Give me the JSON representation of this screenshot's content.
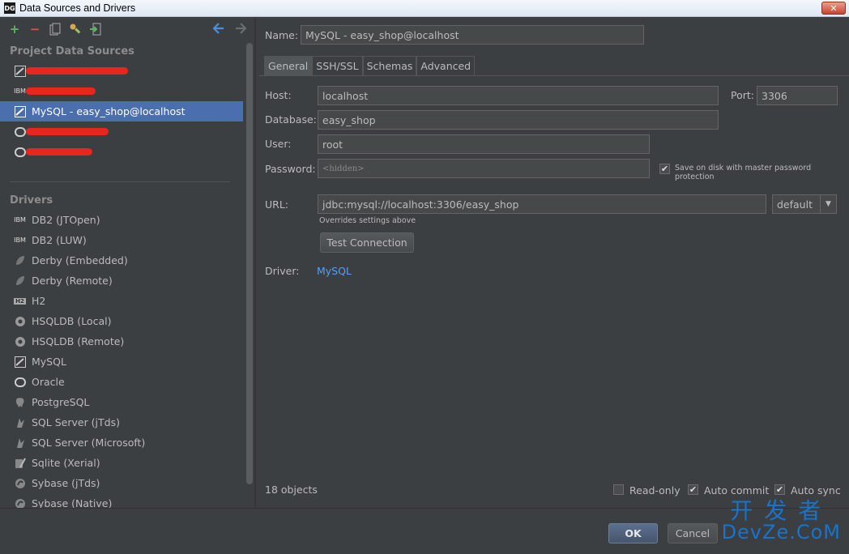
{
  "window": {
    "title": "Data Sources and Drivers",
    "app_icon": "DG",
    "close_label": "✕"
  },
  "left": {
    "toolbar": {
      "add": "+",
      "remove": "−"
    },
    "project_header": "Project Data Sources",
    "sources": [
      {
        "label": "",
        "icon": "mysql-icon"
      },
      {
        "label": "",
        "icon": "ibm-icon"
      },
      {
        "label": "MySQL - easy_shop@localhost",
        "icon": "mysql-icon"
      },
      {
        "label": "",
        "icon": "oracle-icon"
      },
      {
        "label": "",
        "icon": "oracle-icon"
      }
    ],
    "drivers_header": "Drivers",
    "drivers": [
      {
        "label": "DB2 (JTOpen)",
        "icon": "ibm-icon"
      },
      {
        "label": "DB2 (LUW)",
        "icon": "ibm-icon"
      },
      {
        "label": "Derby (Embedded)",
        "icon": "derby-icon"
      },
      {
        "label": "Derby (Remote)",
        "icon": "derby-icon"
      },
      {
        "label": "H2",
        "icon": "h2-icon"
      },
      {
        "label": "HSQLDB (Local)",
        "icon": "hsqldb-icon"
      },
      {
        "label": "HSQLDB (Remote)",
        "icon": "hsqldb-icon"
      },
      {
        "label": "MySQL",
        "icon": "mysql-icon"
      },
      {
        "label": "Oracle",
        "icon": "oracle-icon"
      },
      {
        "label": "PostgreSQL",
        "icon": "postgresql-icon"
      },
      {
        "label": "SQL Server (jTds)",
        "icon": "sqlserver-icon"
      },
      {
        "label": "SQL Server (Microsoft)",
        "icon": "sqlserver-icon"
      },
      {
        "label": "Sqlite (Xerial)",
        "icon": "sqlite-icon"
      },
      {
        "label": "Sybase (jTds)",
        "icon": "sybase-icon"
      },
      {
        "label": "Sybase (Native)",
        "icon": "sybase-icon"
      }
    ]
  },
  "form": {
    "name_label": "Name:",
    "name_value": "MySQL - easy_shop@localhost",
    "tabs": [
      "General",
      "SSH/SSL",
      "Schemas",
      "Advanced"
    ],
    "host_label": "Host:",
    "host_value": "localhost",
    "port_label": "Port:",
    "port_value": "3306",
    "database_label": "Database:",
    "database_value": "easy_shop",
    "user_label": "User:",
    "user_value": "root",
    "password_label": "Password:",
    "password_value": "<hidden>",
    "save_password_label": "Save on disk with master password protection",
    "url_label": "URL:",
    "url_value": "jdbc:mysql://localhost:3306/easy_shop",
    "url_mode": "default",
    "overrides_note": "Overrides settings above",
    "test_connection": "Test Connection",
    "driver_label": "Driver:",
    "driver_value": "MySQL",
    "objects_count": "18 objects",
    "read_only": "Read-only",
    "auto_commit": "Auto commit",
    "auto_sync": "Auto sync"
  },
  "footer": {
    "ok": "OK",
    "cancel": "Cancel"
  },
  "watermark": {
    "line1": "开发者",
    "line2": "DevZe.CoM"
  },
  "colors": {
    "selection": "#4b6eaf",
    "link": "#589df6",
    "redaction": "#e8261c",
    "add": "#5fb45f",
    "remove": "#d9534f"
  }
}
